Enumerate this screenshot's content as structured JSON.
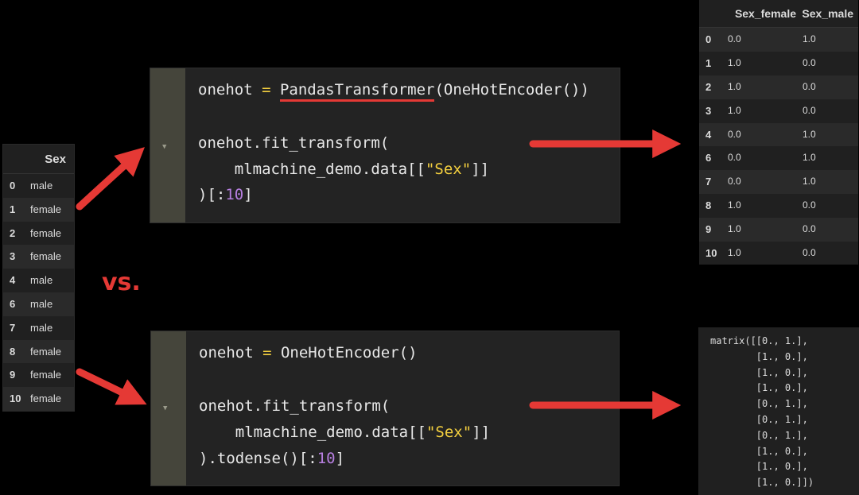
{
  "sex_table": {
    "header": "Sex",
    "rows": [
      {
        "idx": "0",
        "val": "male"
      },
      {
        "idx": "1",
        "val": "female"
      },
      {
        "idx": "2",
        "val": "female"
      },
      {
        "idx": "3",
        "val": "female"
      },
      {
        "idx": "4",
        "val": "male"
      },
      {
        "idx": "6",
        "val": "male"
      },
      {
        "idx": "7",
        "val": "male"
      },
      {
        "idx": "8",
        "val": "female"
      },
      {
        "idx": "9",
        "val": "female"
      },
      {
        "idx": "10",
        "val": "female"
      }
    ]
  },
  "cell1": {
    "l1_a": "onehot ",
    "l1_op": "=",
    "l1_b": " ",
    "l1_cls": "PandasTransformer",
    "l1_c": "(OneHotEncoder())",
    "l2": "onehot.fit_transform(",
    "l3_a": "    mlmachine_demo.data[[",
    "l3_str": "\"Sex\"",
    "l3_b": "]]",
    "l4_a": ")[:",
    "l4_num": "10",
    "l4_b": "]"
  },
  "cell2": {
    "l1_a": "onehot ",
    "l1_op": "=",
    "l1_b": " OneHotEncoder()",
    "l2": "onehot.fit_transform(",
    "l3_a": "    mlmachine_demo.data[[",
    "l3_str": "\"Sex\"",
    "l3_b": "]]",
    "l4_a": ").todense()[:",
    "l4_num": "10",
    "l4_b": "]"
  },
  "vs_label": "vs.",
  "onehot_table": {
    "headers": [
      "Sex_female",
      "Sex_male"
    ],
    "rows": [
      {
        "idx": "0",
        "female": "0.0",
        "male": "1.0"
      },
      {
        "idx": "1",
        "female": "1.0",
        "male": "0.0"
      },
      {
        "idx": "2",
        "female": "1.0",
        "male": "0.0"
      },
      {
        "idx": "3",
        "female": "1.0",
        "male": "0.0"
      },
      {
        "idx": "4",
        "female": "0.0",
        "male": "1.0"
      },
      {
        "idx": "6",
        "female": "0.0",
        "male": "1.0"
      },
      {
        "idx": "7",
        "female": "0.0",
        "male": "1.0"
      },
      {
        "idx": "8",
        "female": "1.0",
        "male": "0.0"
      },
      {
        "idx": "9",
        "female": "1.0",
        "male": "0.0"
      },
      {
        "idx": "10",
        "female": "1.0",
        "male": "0.0"
      }
    ]
  },
  "matrix_output": "matrix([[0., 1.],\n        [1., 0.],\n        [1., 0.],\n        [1., 0.],\n        [0., 1.],\n        [0., 1.],\n        [0., 1.],\n        [1., 0.],\n        [1., 0.],\n        [1., 0.]])",
  "colors": {
    "accent_red": "#e53935",
    "keyword_yellow": "#f4d03f",
    "number_purple": "#b77fe0"
  },
  "icons": {
    "fold": "triangle-down"
  }
}
